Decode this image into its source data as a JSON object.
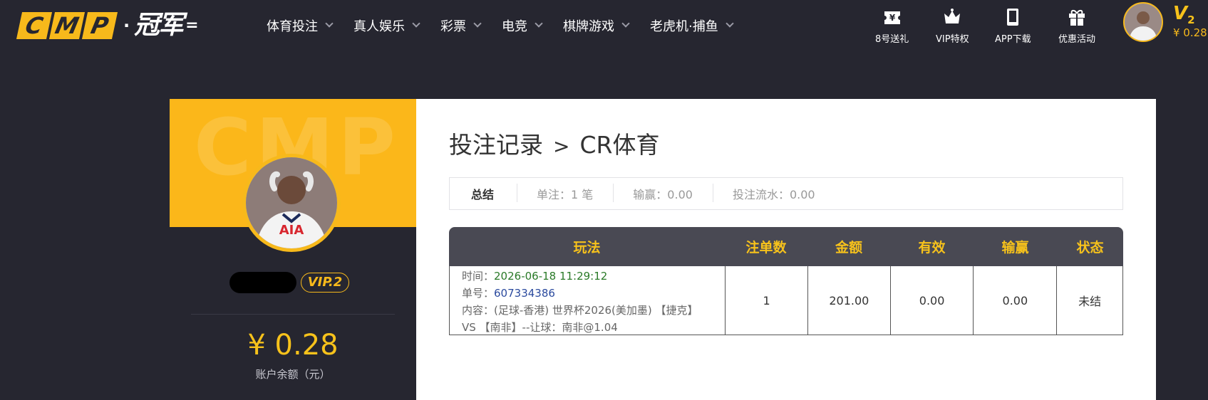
{
  "logo": {
    "letters": [
      "C",
      "M",
      "P"
    ],
    "dot": "·",
    "chinese": "冠军",
    "tail": "="
  },
  "nav": [
    {
      "label": "体育投注"
    },
    {
      "label": "真人娱乐"
    },
    {
      "label": "彩票"
    },
    {
      "label": "电竞"
    },
    {
      "label": "棋牌游戏"
    },
    {
      "label": "老虎机·捕鱼"
    }
  ],
  "quick_links": [
    {
      "label": "8号送礼",
      "icon": "ticket-yen-icon"
    },
    {
      "label": "VIP特权",
      "icon": "crown-icon"
    },
    {
      "label": "APP下载",
      "icon": "tablet-icon"
    },
    {
      "label": "优惠活动",
      "icon": "gift-icon"
    }
  ],
  "account": {
    "vip_letter": "V",
    "vip_level": "2",
    "balance": "¥ 0.28"
  },
  "profile": {
    "banner_watermark": "CMP",
    "vip_badge": "VIP.2",
    "balance": "¥ 0.28",
    "balance_label": "账户余额（元）"
  },
  "breadcrumb": {
    "parent": "投注记录",
    "separator": ">",
    "current": "CR体育"
  },
  "summary": {
    "title": "总结",
    "bets": "单注：1 笔",
    "win_loss": "输赢：0.00",
    "turnover": "投注流水：0.00"
  },
  "table": {
    "headers": [
      "玩法",
      "注单数",
      "金额",
      "有效",
      "输赢",
      "状态"
    ],
    "rows": [
      {
        "time_label": "时间：",
        "time": "2026-06-18 11:29:12",
        "order_label": "单号：",
        "order": "607334386",
        "content_line1": "内容：(足球-香港) 世界杯2026(美加墨) 【捷克】",
        "content_line2": "VS 【南非】--让球：南非@1.04",
        "count": "1",
        "amount": "201.00",
        "valid": "0.00",
        "win_loss": "0.00",
        "status": "未结"
      }
    ]
  },
  "colors": {
    "accent": "#f7b91b",
    "background": "#262630",
    "table_header": "#494953",
    "time_text": "#2a7a28",
    "order_text": "#2b4a9e"
  }
}
